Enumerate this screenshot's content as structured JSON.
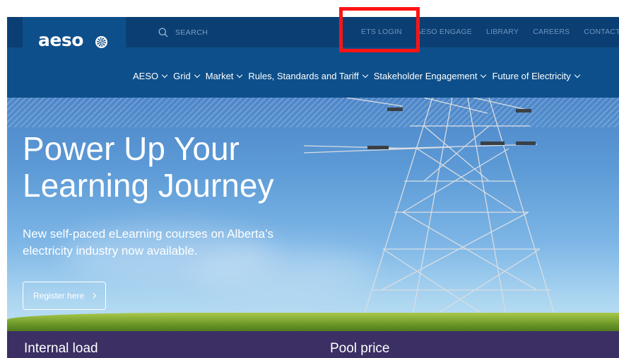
{
  "brand": {
    "name": "aeso",
    "logo_icon": "aeso-swirl-logo"
  },
  "search": {
    "label": "SEARCH",
    "icon": "search-icon"
  },
  "utility_nav": [
    {
      "label": "ETS LOGIN"
    },
    {
      "label": "AESO ENGAGE"
    },
    {
      "label": "LIBRARY"
    },
    {
      "label": "CAREERS"
    },
    {
      "label": "CONTACT US"
    }
  ],
  "main_nav": [
    {
      "label": "AESO"
    },
    {
      "label": "Grid"
    },
    {
      "label": "Market"
    },
    {
      "label": "Rules, Standards and Tariff"
    },
    {
      "label": "Stakeholder Engagement"
    },
    {
      "label": "Future of Electricity"
    }
  ],
  "hero": {
    "title_line1": "Power Up Your",
    "title_line2": "Learning Journey",
    "subtitle": "New self-paced eLearning courses on Alberta’s electricity industry now available.",
    "cta_label": "Register here"
  },
  "stats": {
    "internal_load_title": "Internal load",
    "pool_price_title": "Pool price"
  },
  "colors": {
    "header_bg": "#0d4f8a",
    "topbar_bg": "#0b3f73",
    "stats_bg": "#3b2f63",
    "highlight": "#ff1414"
  }
}
